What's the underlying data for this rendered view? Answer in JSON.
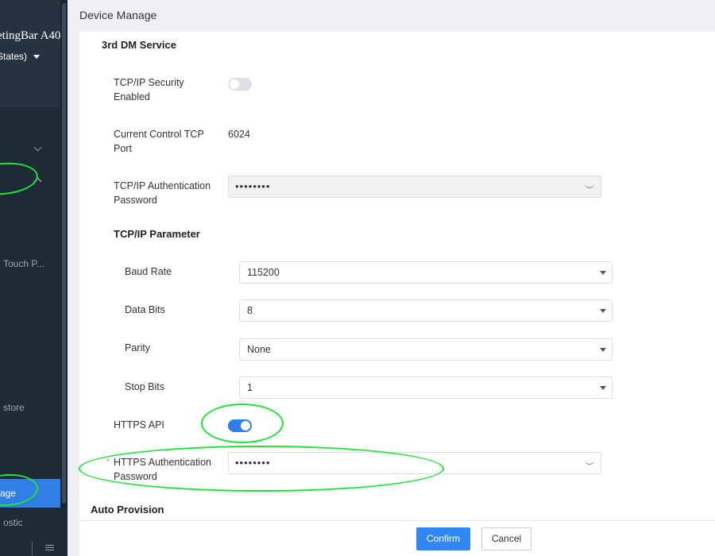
{
  "sidebar": {
    "title": "etingBar A40",
    "region": "States)",
    "items": {
      "touch": "Touch P...",
      "restore": "store",
      "manage": "age",
      "diagnostic": "ostic"
    }
  },
  "page": {
    "title": "Device Manage"
  },
  "section": {
    "title": "3rd DM Service",
    "tcp_security_label": "TCP/IP Security Enabled",
    "tcp_security_on": false,
    "port_label": "Current Control TCP Port",
    "port_value": "6024",
    "tcp_auth_label": "TCP/IP Authentication Password",
    "tcp_auth_value": "••••••••",
    "params_title": "TCP/IP Parameter",
    "baud_label": "Baud Rate",
    "baud_value": "115200",
    "databits_label": "Data Bits",
    "databits_value": "8",
    "parity_label": "Parity",
    "parity_value": "None",
    "stopbits_label": "Stop Bits",
    "stopbits_value": "1",
    "https_api_label": "HTTPS API",
    "https_api_on": true,
    "https_auth_required_mark": "*",
    "https_auth_label": "HTTPS Authentication Password",
    "https_auth_value": "••••••••",
    "auto_provision_title": "Auto Provision"
  },
  "footer": {
    "confirm_label": "Confirm",
    "cancel_label": "Cancel"
  },
  "colors": {
    "accent": "#2f7fe6",
    "annotation": "#22e23a",
    "sidebar_bg": "#1e2a36"
  }
}
